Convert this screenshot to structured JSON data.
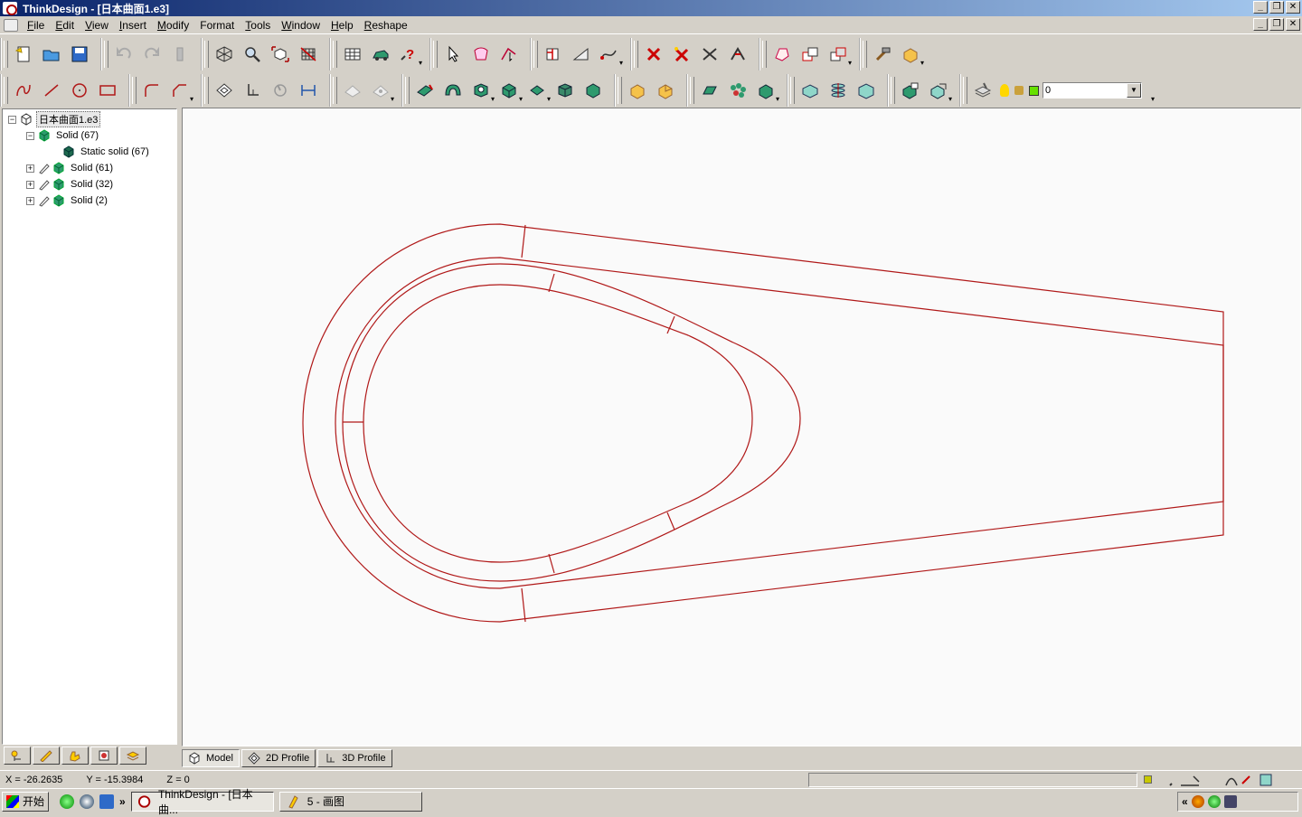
{
  "window": {
    "title": "ThinkDesign - [日本曲面1.e3]",
    "min": "_",
    "restore": "❐",
    "close": "✕"
  },
  "menu": [
    {
      "label": "File",
      "key": "F",
      "rest": "ile"
    },
    {
      "label": "Edit",
      "key": "E",
      "rest": "dit"
    },
    {
      "label": "View",
      "key": "V",
      "rest": "iew"
    },
    {
      "label": "Insert",
      "key": "I",
      "rest": "nsert"
    },
    {
      "label": "Modify",
      "key": "M",
      "rest": "odify"
    },
    {
      "label": "Format",
      "key": "F",
      "rest": "ormat",
      "plain": "Format"
    },
    {
      "label": "Tools",
      "key": "T",
      "rest": "ools"
    },
    {
      "label": "Window",
      "key": "W",
      "rest": "indow"
    },
    {
      "label": "Help",
      "key": "H",
      "rest": "elp"
    },
    {
      "label": "Reshape",
      "key": "R",
      "rest": "eshape"
    }
  ],
  "layer": {
    "value": "0",
    "color": "#66e000"
  },
  "tree": {
    "root": "日本曲面1.e3",
    "items": [
      {
        "label": "Solid (67)",
        "expanded": true
      },
      {
        "label": "Static solid (67)",
        "child": true
      },
      {
        "label": "Solid (61)"
      },
      {
        "label": "Solid (32)"
      },
      {
        "label": "Solid (2)"
      }
    ]
  },
  "view_tabs": {
    "model": "Model",
    "profile2d": "2D Profile",
    "profile3d": "3D Profile"
  },
  "status": {
    "x": "X = -26.2635",
    "y": "Y = -15.3984",
    "z": "Z = 0"
  },
  "taskbar": {
    "start": "开始",
    "chevron": "»",
    "task1": "ThinkDesign - [日本曲...",
    "task2": "5 - 画图",
    "tray_chevron": "«"
  },
  "colors": {
    "curve": "#b01818",
    "solid_icon": "#2e9a6e"
  }
}
